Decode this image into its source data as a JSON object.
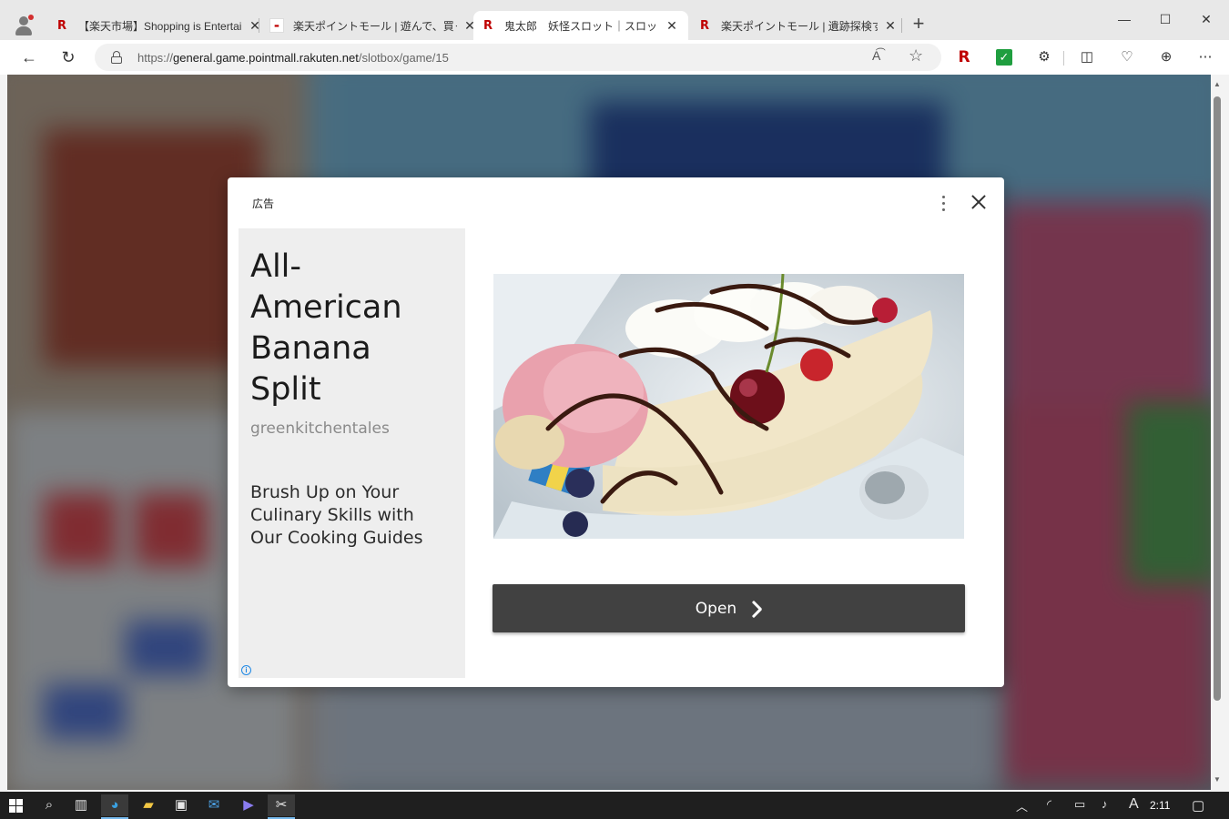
{
  "browser": {
    "tabs": [
      {
        "title": "【楽天市場】Shopping is Entertain",
        "favicon": "rakuten-r-icon",
        "active": false
      },
      {
        "title": "楽天ポイントモール | 遊んで、買って楽",
        "favicon": "pointmall-icon",
        "active": false
      },
      {
        "title": "鬼太郎　妖怪スロット｜スロットパラ",
        "favicon": "rakuten-r-icon",
        "active": true
      },
      {
        "title": "楽天ポイントモール | 遺跡探検すごろ",
        "favicon": "rakuten-r-icon",
        "active": false
      }
    ],
    "new_tab_label": "+",
    "address": {
      "scheme": "https://",
      "host": "general.game.pointmall.rakuten.net",
      "path": "/slotbox/game/15"
    },
    "read_aloud_label": "A͡",
    "rakuten_ext_label": "R",
    "accent": "#bf0000"
  },
  "ad": {
    "label": "広告",
    "headline": "All-American Banana Split",
    "advertiser": "greenkitchentales",
    "body": "Brush Up on Your Culinary Skills with Our Cooking Guides",
    "open_label": "Open",
    "info_glyph": "i",
    "panel_color": "#eeeeee",
    "button_color": "#414141"
  },
  "taskbar": {
    "ime": "A",
    "clock": "2:11"
  }
}
